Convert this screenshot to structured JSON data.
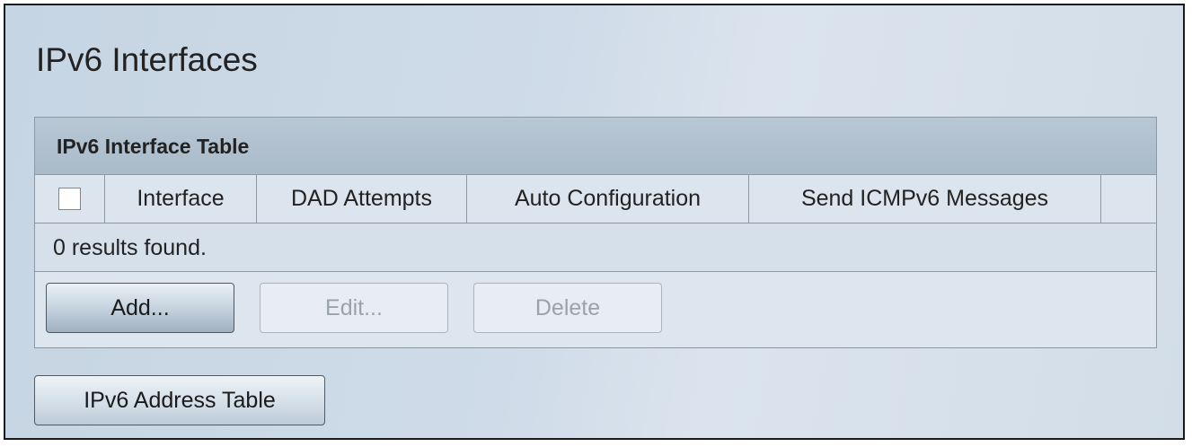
{
  "page": {
    "title": "IPv6 Interfaces"
  },
  "interface_table": {
    "caption": "IPv6 Interface Table",
    "columns": [
      "Interface",
      "DAD Attempts",
      "Auto Configuration",
      "Send ICMPv6 Messages",
      ""
    ],
    "rows": [],
    "results_text": "0 results found.",
    "select_all_checked": false
  },
  "actions": {
    "add_label": "Add...",
    "edit_label": "Edit...",
    "delete_label": "Delete",
    "edit_enabled": false,
    "delete_enabled": false
  },
  "address_table_button": {
    "label": "IPv6 Address Table"
  }
}
